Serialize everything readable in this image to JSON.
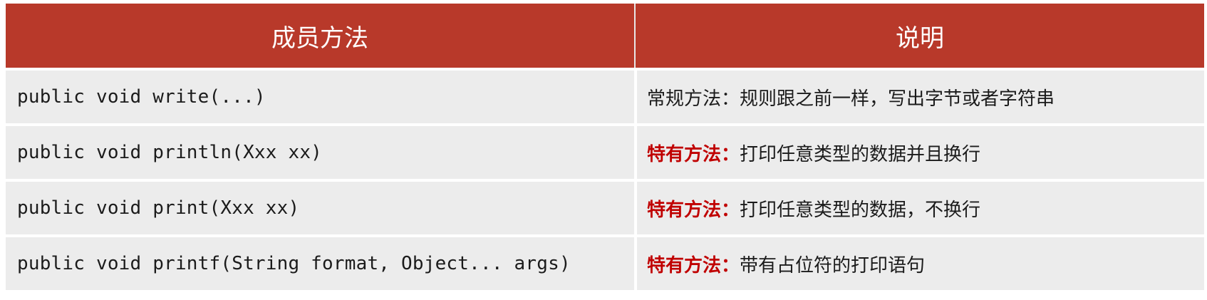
{
  "header": {
    "col_method": "成员方法",
    "col_desc": "说明"
  },
  "rows": [
    {
      "method": "public void write(...)",
      "tag": "",
      "desc": "常规方法：规则跟之前一样，写出字节或者字符串"
    },
    {
      "method": "public void println(Xxx xx)",
      "tag": "特有方法：",
      "desc": "打印任意类型的数据并且换行"
    },
    {
      "method": "public void print(Xxx xx)",
      "tag": "特有方法：",
      "desc": "打印任意类型的数据，不换行"
    },
    {
      "method": "public void printf(String format, Object... args)",
      "tag": "特有方法：",
      "desc": "带有占位符的打印语句"
    }
  ],
  "colors": {
    "header_bg": "#b8392a",
    "tag_color": "#c00000",
    "row_bg": "#ececec"
  }
}
